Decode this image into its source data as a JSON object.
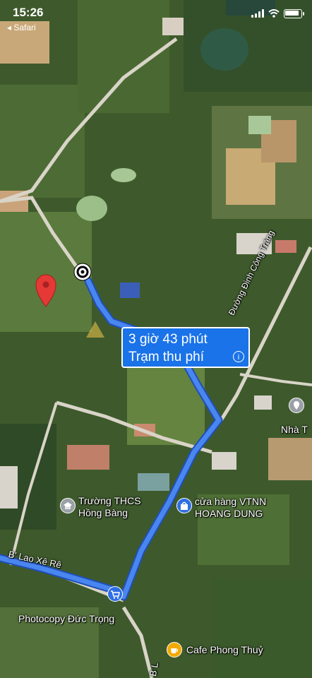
{
  "status_bar": {
    "time": "15:26",
    "back_label": "◂ Safari"
  },
  "route": {
    "duration": "3 giờ 43 phút",
    "via": "Trạm thu phí"
  },
  "places": {
    "school_line1": "Trường THCS",
    "school_line2": "Hồng Bàng",
    "store_line1": "cửa hàng VTNN",
    "store_line2": "HOANG DUNG",
    "photocopy": "Photocopy Đức Trọng",
    "cafe": "Cafe Phong Thuỷ",
    "nha": "Nhà T"
  },
  "roads": {
    "dinh_cong_trang": "Đường Đinh Công Tráng",
    "blao_xe_re": "B' Lao Xê Rê",
    "bl_road": "B L"
  },
  "colors": {
    "route_line": "#4a86f0",
    "callout_bg": "#1a73e8",
    "pin": "#e53935",
    "cafe_icon": "#f2a900",
    "store_icon": "#2f6fe4",
    "school_icon": "#9aa0a6"
  },
  "icons": {
    "start": "origin-icon",
    "pin": "map-pin-icon",
    "school": "school-icon",
    "store": "shopping-bag-icon",
    "shop": "shopping-cart-icon",
    "cafe": "cafe-icon",
    "nha": "place-icon",
    "toll": "info-icon"
  }
}
